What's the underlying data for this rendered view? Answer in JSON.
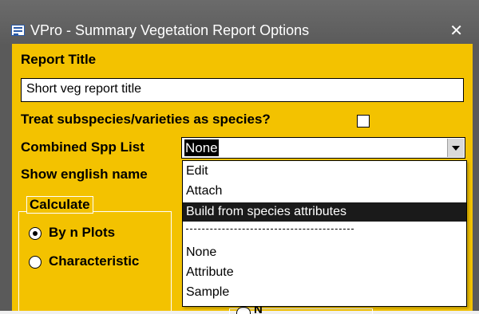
{
  "window": {
    "title": "VPro - Summary Vegetation Report Options",
    "close_label": "✕"
  },
  "form": {
    "report_title_label": "Report Title",
    "report_title_value": "Short veg report title",
    "treat_subspecies_label": "Treat subspecies/varieties as species?",
    "treat_subspecies_checked": false,
    "combined_spp_label": "Combined Spp List",
    "combined_spp_value": "None",
    "show_english_label": "Show english name",
    "calculate_group": {
      "legend": "Calculate",
      "options": [
        {
          "label": "By n Plots",
          "selected": true
        },
        {
          "label": "Characteristic",
          "selected": false
        }
      ]
    },
    "bottom_option_label": "N"
  },
  "dropdown": {
    "items": [
      {
        "label": "Edit",
        "selected": false
      },
      {
        "label": "Attach",
        "selected": false
      },
      {
        "label": "Build from species attributes",
        "selected": true
      },
      {
        "label": "None",
        "selected": false
      },
      {
        "label": "Attribute",
        "selected": false
      },
      {
        "label": "Sample",
        "selected": false
      }
    ]
  },
  "colors": {
    "form_background": "#f3c200",
    "titlebar": "#5b5b5b",
    "selection": "#1a1a1a"
  }
}
